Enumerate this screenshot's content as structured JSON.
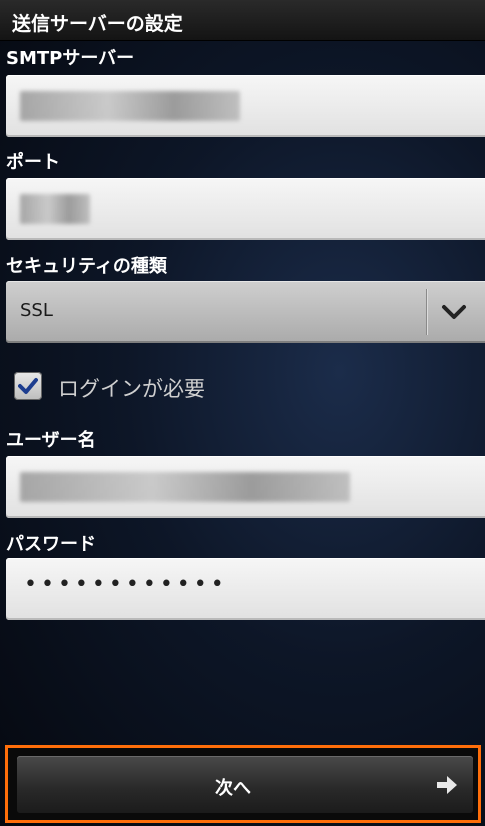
{
  "header": {
    "title": "送信サーバーの設定"
  },
  "form": {
    "smtp_server": {
      "label": "SMTPサーバー",
      "value": ""
    },
    "port": {
      "label": "ポート",
      "value": ""
    },
    "security_type": {
      "label": "セキュリティの種類",
      "selected": "SSL"
    },
    "login_required": {
      "label": "ログインが必要",
      "checked": true
    },
    "username": {
      "label": "ユーザー名",
      "value": ""
    },
    "password": {
      "label": "パスワード",
      "masked_value": "••••••••••••"
    }
  },
  "footer": {
    "next_label": "次へ",
    "highlight_color": "#ff6e0a"
  },
  "icons": {
    "select_arrow": "chevron-down-icon",
    "checkbox_mark": "checkmark-icon",
    "next_arrow": "arrow-right-icon"
  }
}
